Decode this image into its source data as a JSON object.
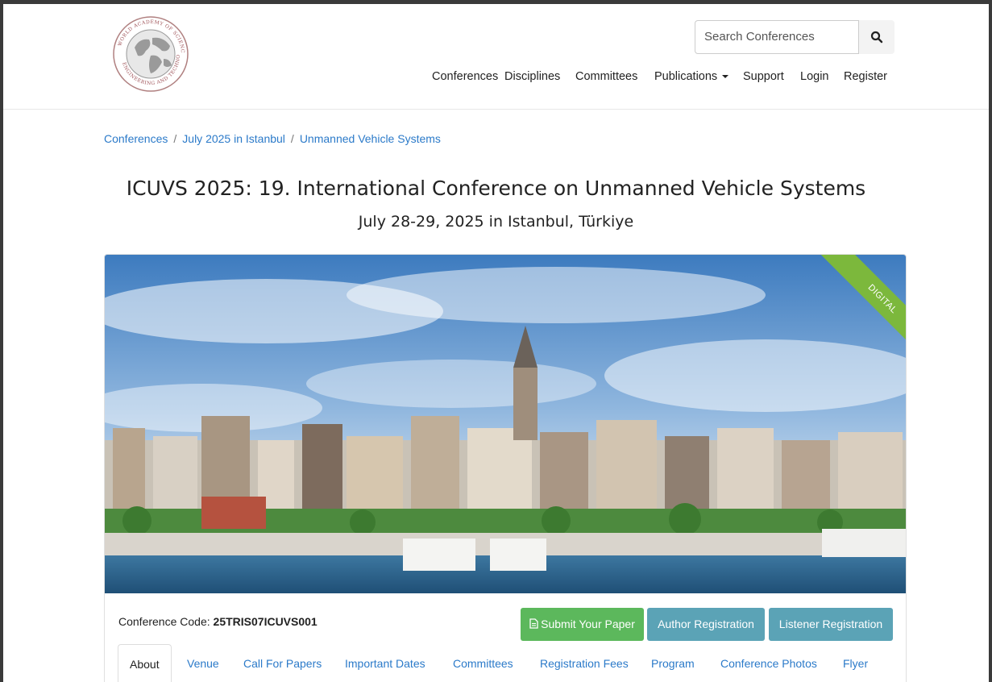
{
  "header": {
    "search_placeholder": "Search Conferences",
    "icons": {
      "search": "search-icon",
      "logo": "globe-logo"
    },
    "logo_text": "WORLD ACADEMY OF SCIENCE, ENGINEERING AND TECHNOLOGY",
    "nav": [
      "Conferences",
      "Disciplines",
      "Committees",
      "Publications",
      "Support",
      "Login",
      "Register"
    ]
  },
  "breadcrumb": [
    "Conferences",
    "July 2025 in Istanbul",
    "Unmanned Vehicle Systems"
  ],
  "page": {
    "title": "ICUVS 2025: 19. International Conference on Unmanned Vehicle Systems",
    "subtitle": "July 28-29, 2025 in Istanbul, Türkiye"
  },
  "banner": {
    "ribbon": "DIGITAL",
    "ribbon_color": "#7cb83c"
  },
  "conference": {
    "code_label": "Conference Code:",
    "code_value": "25TRIS07ICUVS001"
  },
  "actions": {
    "submit": "Submit Your Paper",
    "author": "Author Registration",
    "listener": "Listener Registration",
    "submit_color": "#5cb85c",
    "registration_color": "#5ba3b6"
  },
  "tabs": [
    "About",
    "Venue",
    "Call For Papers",
    "Important Dates",
    "Committees",
    "Registration Fees",
    "Program",
    "Conference Photos",
    "Flyer"
  ],
  "colors": {
    "link": "#2b7ac9"
  }
}
